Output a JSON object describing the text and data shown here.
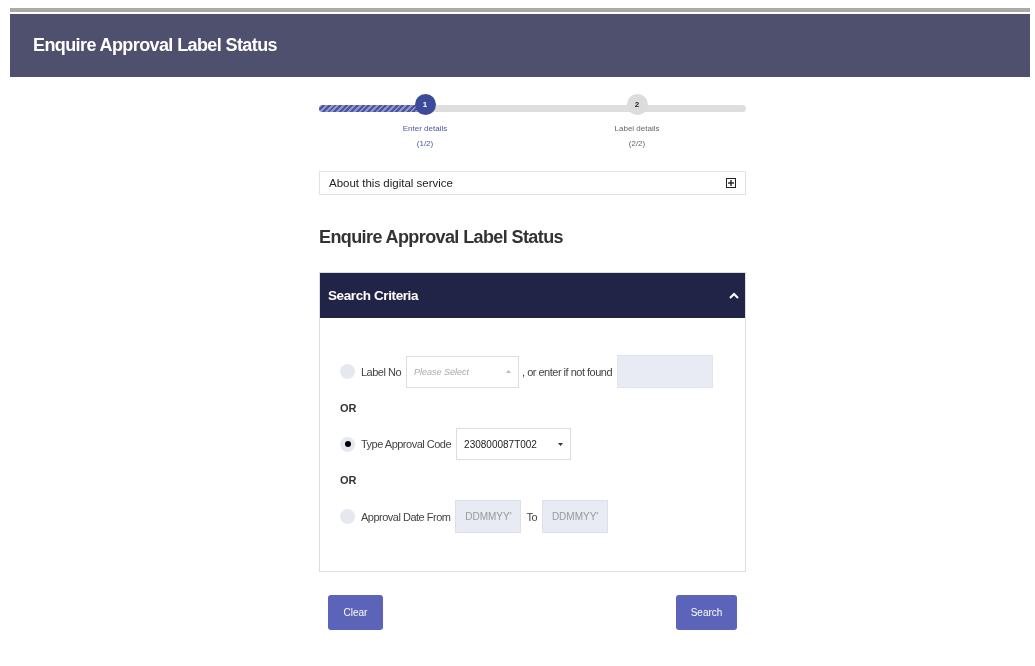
{
  "header": {
    "title": "Enquire Approval Label Status"
  },
  "stepper": {
    "level": 0.25,
    "steps": [
      {
        "number": "1",
        "label": "Enter details",
        "fraction": "(1/2)",
        "selected": true
      },
      {
        "number": "2",
        "label": "Label details",
        "fraction": "(2/2)",
        "selected": false
      }
    ]
  },
  "about": {
    "label": "About this digital service",
    "expanded": false
  },
  "heading": "Enquire Approval Label Status",
  "panel": {
    "title": "Search Criteria",
    "expanded": true,
    "options": [
      {
        "kind": "label_no",
        "selected": false,
        "label": "Label No",
        "select_placeholder": "Please Select",
        "note": ", or enter if not found"
      },
      {
        "kind": "separator",
        "label": "OR"
      },
      {
        "kind": "approval_code",
        "selected": true,
        "label": "Type Approval Code",
        "value": "230800087T002"
      },
      {
        "kind": "separator",
        "label": "OR"
      },
      {
        "kind": "date_range",
        "selected": false,
        "label": "Approval Date From",
        "from_placeholder": "DDMMYY'",
        "to_label": "To",
        "to_placeholder": "DDMMYY'"
      }
    ]
  },
  "buttons": {
    "clear": "Clear",
    "search": "Search"
  }
}
